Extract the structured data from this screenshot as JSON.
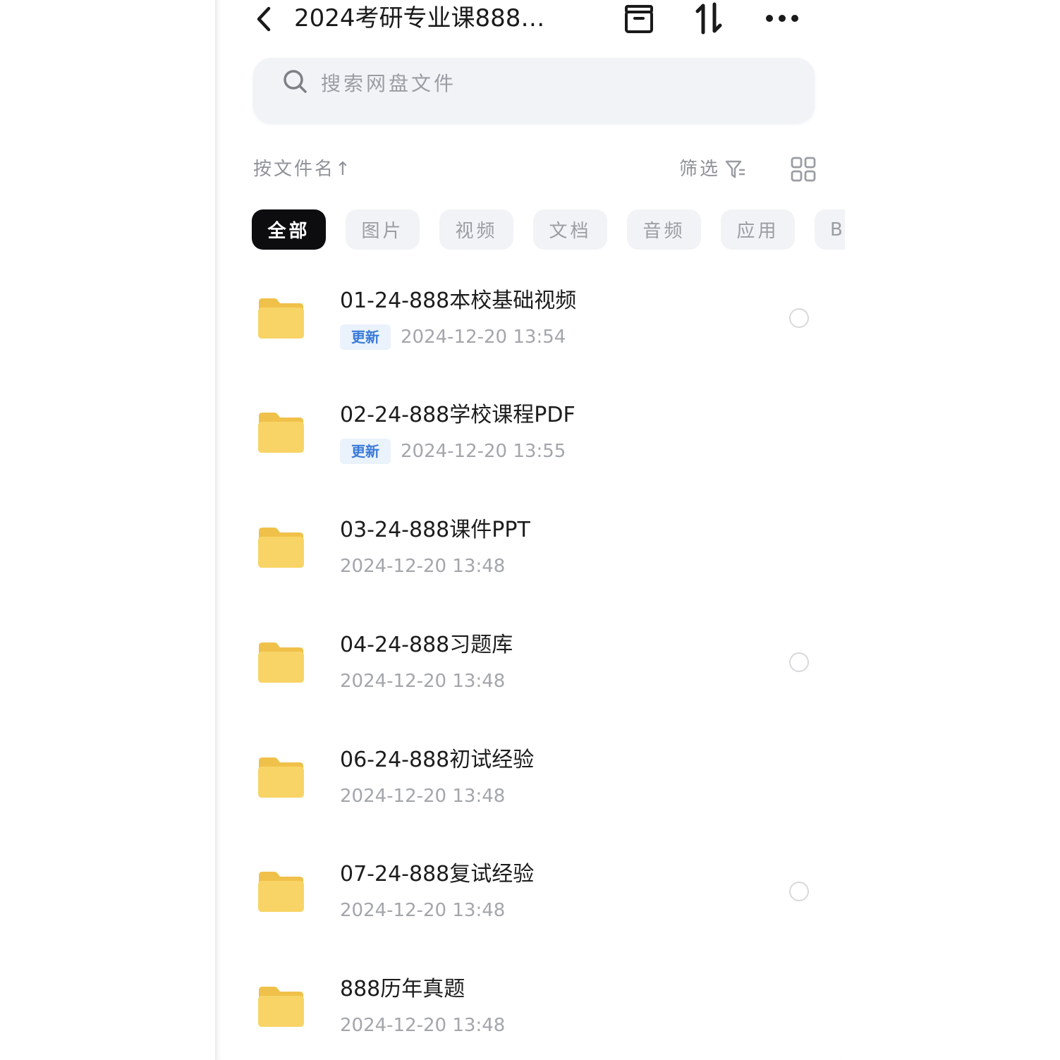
{
  "header": {
    "title": "2024考研专业课888…",
    "back_icon": "chevron-left-icon",
    "actions": [
      {
        "name": "archive-icon"
      },
      {
        "name": "sort-swap-icon"
      },
      {
        "name": "more-horizontal-icon"
      }
    ]
  },
  "search": {
    "placeholder": "搜索网盘文件",
    "icon": "search-icon"
  },
  "toolbar": {
    "sort_label": "按文件名↑",
    "filter_label": "筛选",
    "filter_icon": "filter-icon",
    "grid_icon": "grid-view-icon"
  },
  "tabs": [
    {
      "label": "全部",
      "active": true
    },
    {
      "label": "图片",
      "active": false
    },
    {
      "label": "视频",
      "active": false
    },
    {
      "label": "文档",
      "active": false
    },
    {
      "label": "音频",
      "active": false
    },
    {
      "label": "应用",
      "active": false
    },
    {
      "label": "BT",
      "active": false
    }
  ],
  "files": [
    {
      "name": "01-24-888本校基础视频",
      "badge": "更新",
      "date": "2024-12-20  13:54"
    },
    {
      "name": "02-24-888学校课程PDF",
      "badge": "更新",
      "date": "2024-12-20  13:55"
    },
    {
      "name": "03-24-888课件PPT",
      "badge": "",
      "date": "2024-12-20  13:48"
    },
    {
      "name": "04-24-888习题库",
      "badge": "",
      "date": "2024-12-20  13:48"
    },
    {
      "name": "06-24-888初试经验",
      "badge": "",
      "date": "2024-12-20  13:48"
    },
    {
      "name": "07-24-888复试经验",
      "badge": "",
      "date": "2024-12-20  13:48"
    },
    {
      "name": "888历年真题",
      "badge": "",
      "date": "2024-12-20  13:48"
    }
  ],
  "colors": {
    "folder": "#f8d466",
    "folder_dark": "#f0c14a",
    "badge_text": "#3a7ad8",
    "tab_active": "#0d0d10"
  }
}
